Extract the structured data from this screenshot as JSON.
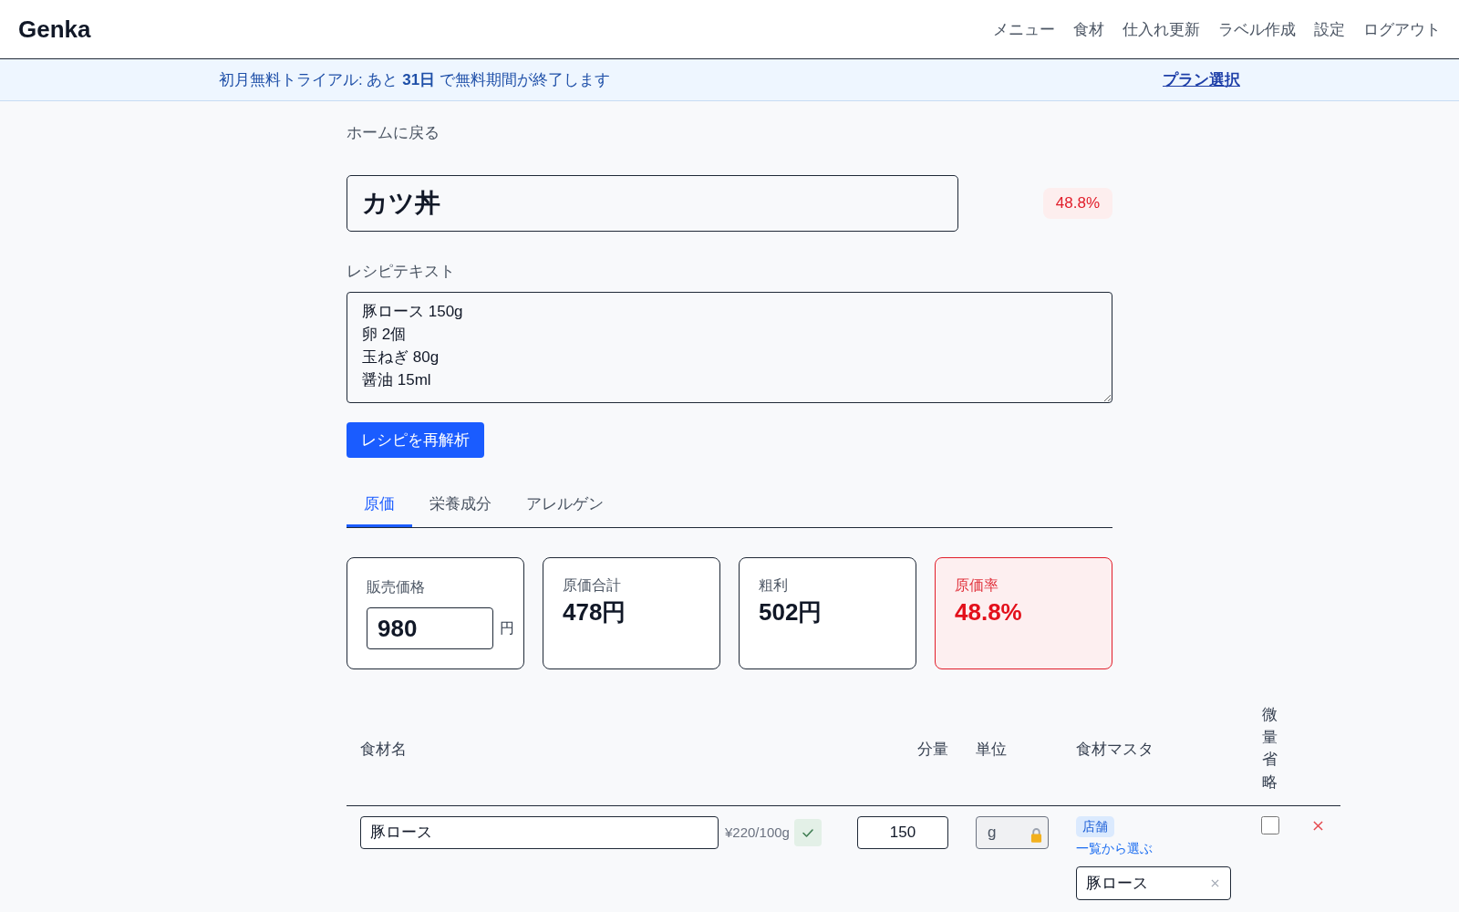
{
  "header": {
    "logo": "Genka",
    "nav": [
      "メニュー",
      "食材",
      "仕入れ更新",
      "ラベル作成",
      "設定",
      "ログアウト"
    ]
  },
  "trial_banner": {
    "message": "初月無料トライアル: あと **31日** で無料期間が終了します",
    "link": "プラン選択"
  },
  "back_link": "ホームに戻る",
  "recipe": {
    "name": "カツ丼",
    "cost_badge": {
      "text": "48.8%",
      "alert": true
    },
    "text_label": "レシピテキスト",
    "text_lines": [
      "豚ロース 150g",
      "卵 2個",
      "玉ねぎ 80g",
      "醤油 15ml"
    ],
    "reparse_button": "レシピを再解析"
  },
  "tabs": [
    {
      "label": "原価",
      "selected": true
    },
    {
      "label": "栄養成分",
      "selected": false
    },
    {
      "label": "アレルゲン",
      "selected": false
    }
  ],
  "summary_cards": [
    {
      "kind": "input",
      "label": "販売価格",
      "value": "980",
      "unit": "円",
      "alert": false
    },
    {
      "kind": "stat",
      "label": "原価合計",
      "value": "478円",
      "alert": false
    },
    {
      "kind": "stat",
      "label": "粗利",
      "value": "502円",
      "alert": false
    },
    {
      "kind": "stat",
      "label": "原価率",
      "value": "48.8%",
      "alert": true
    }
  ],
  "ingredients": {
    "columns": [
      {
        "label": "食材名",
        "kind": "name"
      },
      {
        "label": "分量",
        "kind": "quantity"
      },
      {
        "label": "単位",
        "kind": "unit"
      },
      {
        "label": "食材マスタ",
        "kind": "master"
      },
      {
        "label": "微量省略",
        "kind": "flag"
      }
    ],
    "rows": [
      {
        "name": "豚ロース",
        "unit_price": "¥220/100g",
        "matched": true,
        "quantity": "150",
        "unit": "g",
        "unit_locked": true,
        "master_tag": "店舗",
        "master_link": "一覧から選ぶ",
        "master_value": "豚ロース",
        "trace_omit": false
      }
    ]
  }
}
